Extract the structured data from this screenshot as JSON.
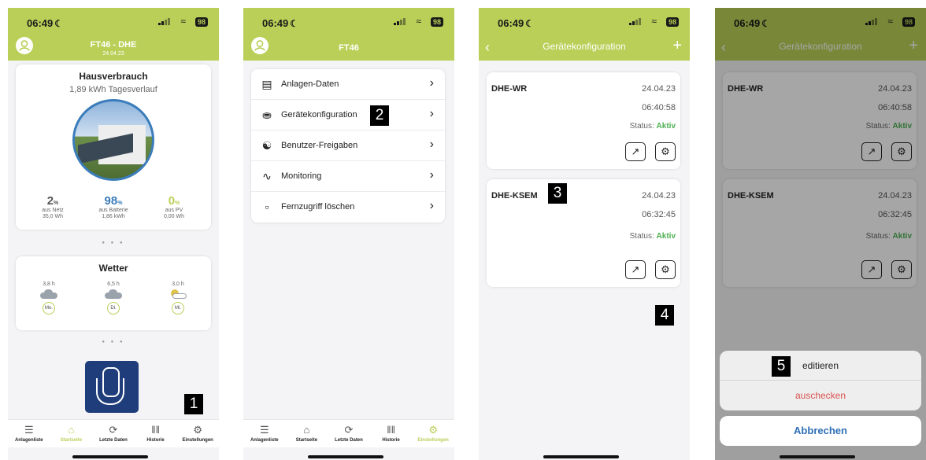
{
  "status": {
    "time": "06:49",
    "battery": "98"
  },
  "screen1": {
    "title": "FT46 - DHE",
    "date": "24.04.23",
    "consumption": {
      "title": "Hausverbrauch",
      "subtitle": "1,89 kWh Tagesverlauf"
    },
    "stats": [
      {
        "value": "2",
        "unit": "%",
        "label": "aus Netz",
        "sub": "35,0 Wh",
        "color": "#555555"
      },
      {
        "value": "98",
        "unit": "%",
        "label": "aus Batterie",
        "sub": "1,86 kWh",
        "color": "#3b7dbb"
      },
      {
        "value": "0",
        "unit": "%",
        "label": "aus PV",
        "sub": "0,00 Wh",
        "color": "#b9cf57"
      }
    ],
    "weather": {
      "title": "Wetter",
      "days": [
        {
          "hours": "3,8 h",
          "day": "Mo.",
          "icon": "rain-cloud-icon"
        },
        {
          "hours": "6,5 h",
          "day": "Di.",
          "icon": "rain-cloud-icon"
        },
        {
          "hours": "3,0 h",
          "day": "Mi.",
          "icon": "sun-cloud-icon"
        }
      ]
    },
    "badge": "1"
  },
  "tabs": [
    {
      "label": "Anlagenliste",
      "icon": "list-icon"
    },
    {
      "label": "Startseite",
      "icon": "home-icon"
    },
    {
      "label": "Letzte Daten",
      "icon": "refresh-icon"
    },
    {
      "label": "Historie",
      "icon": "bar-chart-icon"
    },
    {
      "label": "Einstellungen",
      "icon": "gear-icon"
    }
  ],
  "screen2": {
    "title": "FT46",
    "menu": [
      {
        "label": "Anlagen-Daten",
        "icon": "server-icon"
      },
      {
        "label": "Gerätekonfiguration",
        "icon": "database-icon"
      },
      {
        "label": "Benutzer-Freigaben",
        "icon": "add-user-icon"
      },
      {
        "label": "Monitoring",
        "icon": "pulse-icon"
      },
      {
        "label": "Fernzugriff löschen",
        "icon": "trash-icon"
      }
    ],
    "badge": "2"
  },
  "screen3": {
    "title": "Gerätekonfiguration",
    "devices": [
      {
        "name": "DHE-WR",
        "date": "24.04.23",
        "time": "06:40:58",
        "status_label": "Status:",
        "status_value": "Aktiv"
      },
      {
        "name": "DHE-KSEM",
        "date": "24.04.23",
        "time": "06:32:45",
        "status_label": "Status:",
        "status_value": "Aktiv"
      }
    ],
    "badge3": "3",
    "badge4": "4"
  },
  "screen4": {
    "sheet": {
      "edit": "editieren",
      "checkout": "auschecken",
      "cancel": "Abbrechen"
    },
    "badge": "5"
  }
}
